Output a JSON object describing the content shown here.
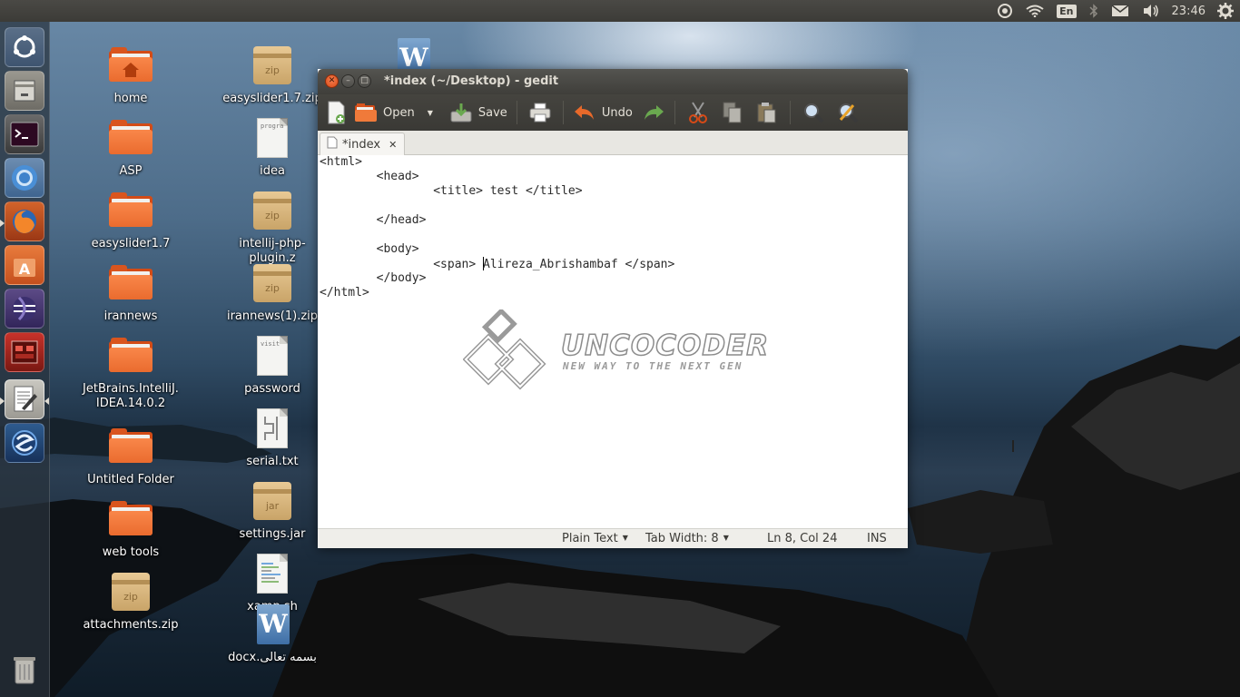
{
  "top_panel": {
    "indicators": [
      "ubuntu-one-icon",
      "wifi-icon",
      "keyboard-layout",
      "bluetooth-icon",
      "mail-icon",
      "volume-icon"
    ],
    "keyboard_layout": "En",
    "clock": "23:46",
    "session_icon": "gear-icon"
  },
  "launcher": {
    "items": [
      {
        "name": "dash-icon"
      },
      {
        "name": "files-icon"
      },
      {
        "name": "terminal-icon"
      },
      {
        "name": "chromium-icon"
      },
      {
        "name": "firefox-icon"
      },
      {
        "name": "software-center-icon"
      },
      {
        "name": "eclipse-icon"
      },
      {
        "name": "app-red-icon"
      },
      {
        "name": "gedit-icon",
        "running": true
      },
      {
        "name": "app-blue-icon"
      }
    ],
    "trash": "trash-icon"
  },
  "desktop": {
    "col1": [
      {
        "label": "home",
        "type": "folder-home"
      },
      {
        "label": "ASP",
        "type": "folder"
      },
      {
        "label": "easyslider1.7",
        "type": "folder"
      },
      {
        "label": "irannews",
        "type": "folder"
      },
      {
        "label": "JetBrains.IntelliJ.IDEA.14.0.2",
        "line1": "JetBrains.IntelliJ.",
        "line2": "IDEA.14.0.2",
        "type": "folder"
      },
      {
        "label": "Untitled Folder",
        "type": "folder"
      },
      {
        "label": "web tools",
        "type": "folder"
      },
      {
        "label": "attachments.zip",
        "type": "zip",
        "badge": "zip"
      }
    ],
    "col2": [
      {
        "label": "easyslider1.7.zip",
        "type": "zip",
        "badge": "zip"
      },
      {
        "label": "idea",
        "type": "text",
        "preview": "progra"
      },
      {
        "label": "intellij-php-plugin.z",
        "type": "zip",
        "badge": "zip"
      },
      {
        "label": "irannews(1).zip",
        "type": "zip",
        "badge": "zip"
      },
      {
        "label": "password",
        "type": "text",
        "preview": "visit"
      },
      {
        "label": "serial.txt",
        "type": "text",
        "preview": ""
      },
      {
        "label": "settings.jar",
        "type": "zip",
        "badge": "jar"
      },
      {
        "label": "xamp.sh",
        "type": "text",
        "preview": ""
      },
      {
        "label": "بسمه تعالی.docx",
        "type": "word",
        "badge": "W"
      }
    ],
    "top_word_badge": "W"
  },
  "gedit": {
    "title": "*index (~/Desktop) - gedit",
    "toolbar": {
      "open_label": "Open",
      "save_label": "Save",
      "undo_label": "Undo"
    },
    "tab": {
      "label": "*index",
      "close": "✕"
    },
    "code_lines": [
      "<html>",
      "        <head>",
      "                <title> test </title>",
      "",
      "        </head>",
      "",
      "        <body>"
    ],
    "line8_before": "                <span> ",
    "line8_after": "Alireza_Abrishambaf </span>",
    "code_lines_end": [
      "        </body>",
      "</html>"
    ],
    "watermark": {
      "text": "UNCOCODER",
      "subtitle": "NEW WAY TO THE NEXT GEN"
    },
    "status": {
      "language": "Plain Text",
      "tab_width": "Tab Width: 8",
      "position": "Ln 8, Col 24",
      "mode": "INS"
    }
  }
}
